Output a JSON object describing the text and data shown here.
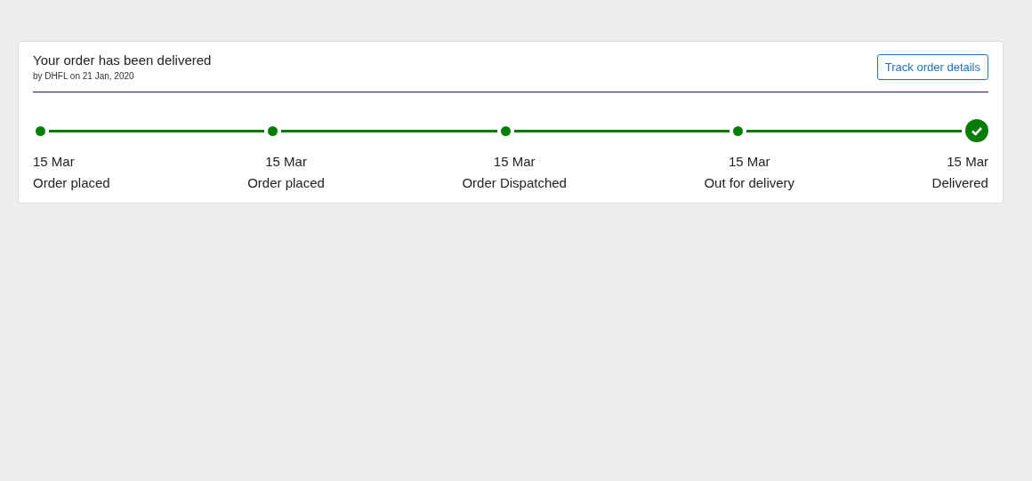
{
  "order": {
    "title": "Your order has been delivered",
    "subtitle": "by DHFL on 21 Jan, 2020",
    "button": "Track order details"
  },
  "steps": [
    {
      "date": "15 Mar",
      "label": "Order placed",
      "kind": "dot",
      "completed": true
    },
    {
      "date": "15 Mar",
      "label": "Order placed",
      "kind": "dot",
      "completed": true
    },
    {
      "date": "15 Mar",
      "label": "Order Dispatched",
      "kind": "dot",
      "completed": true
    },
    {
      "date": "15 Mar",
      "label": "Out for delivery",
      "kind": "dot",
      "completed": true
    },
    {
      "date": "15 Mar",
      "label": "Delivered",
      "kind": "check",
      "completed": true
    }
  ]
}
